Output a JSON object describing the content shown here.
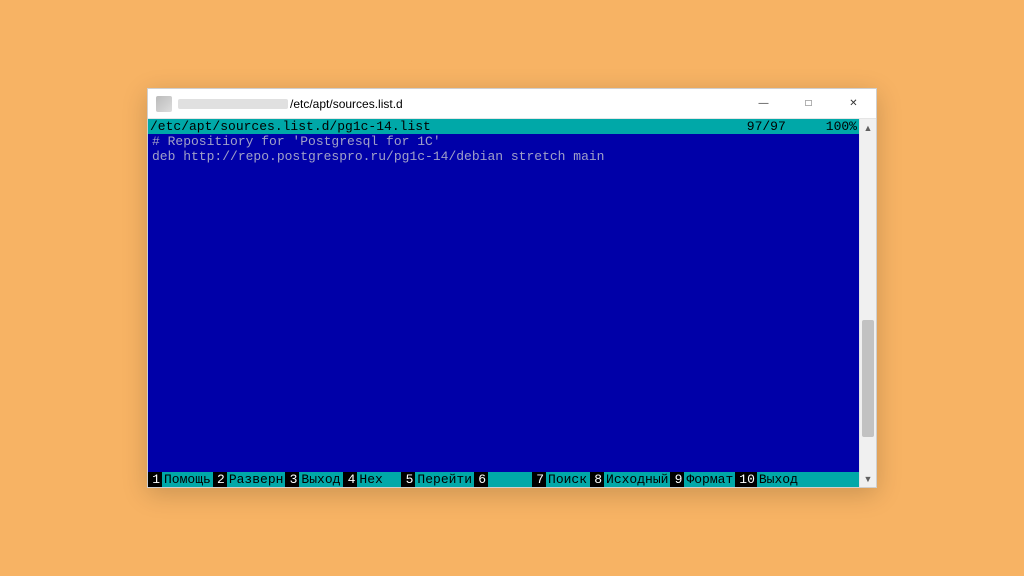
{
  "titlebar": {
    "path": "/etc/apt/sources.list.d"
  },
  "status": {
    "file": "/etc/apt/sources.list.d/pg1c-14.list",
    "position": "97/97",
    "percent": "100%"
  },
  "editor": {
    "line1": "# Repositiory for 'Postgresql for 1C'",
    "line2": "deb http://repo.postgrespro.ru/pg1c-14/debian stretch main"
  },
  "fkeys": [
    {
      "n": "1",
      "label": "Помощь"
    },
    {
      "n": "2",
      "label": "Разверн"
    },
    {
      "n": "3",
      "label": "Выход"
    },
    {
      "n": "4",
      "label": "Hex"
    },
    {
      "n": "5",
      "label": "Перейти"
    },
    {
      "n": "6",
      "label": ""
    },
    {
      "n": "7",
      "label": "Поиск"
    },
    {
      "n": "8",
      "label": "Исходный"
    },
    {
      "n": "9",
      "label": "Формат"
    },
    {
      "n": "10",
      "label": "Выход"
    }
  ]
}
